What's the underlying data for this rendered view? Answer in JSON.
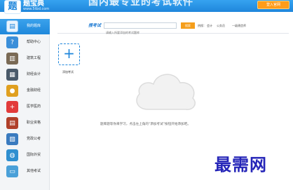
{
  "header": {
    "logo_char": "题",
    "logo_name": "题宝典",
    "logo_url": "www.5tbd.com",
    "slogan": "国内最专业的考试软件",
    "login_button": "登入官网"
  },
  "sidebar": {
    "items": [
      {
        "label": "我的题库",
        "icon": "book-icon",
        "color": "#1f86db",
        "active": true
      },
      {
        "label": "帮助中心",
        "icon": "help-icon",
        "color": "#3b8fd9",
        "active": false
      },
      {
        "label": "建筑工程",
        "icon": "building-icon",
        "color": "#7a6a55",
        "active": false
      },
      {
        "label": "财经会计",
        "icon": "finance-icon",
        "color": "#4a5a6a",
        "active": false
      },
      {
        "label": "金融财经",
        "icon": "globe-coin-icon",
        "color": "#e0a020",
        "active": false
      },
      {
        "label": "医学医药",
        "icon": "medical-cross-icon",
        "color": "#e23b3b",
        "active": false
      },
      {
        "label": "职业资格",
        "icon": "books-icon",
        "color": "#b0402a",
        "active": false
      },
      {
        "label": "党政公考",
        "icon": "document-icon",
        "color": "#3a7bbf",
        "active": false
      },
      {
        "label": "国际外贸",
        "icon": "globe-icon",
        "color": "#2f8fd0",
        "active": false
      },
      {
        "label": "其他考试",
        "icon": "folder-icon",
        "color": "#4aa0d8",
        "active": false
      }
    ]
  },
  "search": {
    "title": "搜考试",
    "placeholder": "请输入所要添加的考试题库",
    "button": "搜索",
    "hot_label": "热搜：",
    "hot_links": [
      "会计",
      "公务员",
      "一级建造师"
    ]
  },
  "add_exam": {
    "label": "添加考试"
  },
  "empty_state": {
    "message": "题库题等你来学习，点击左上角的“添加考试”按钮开始添加吧。"
  },
  "watermark": {
    "text": "最需网"
  }
}
